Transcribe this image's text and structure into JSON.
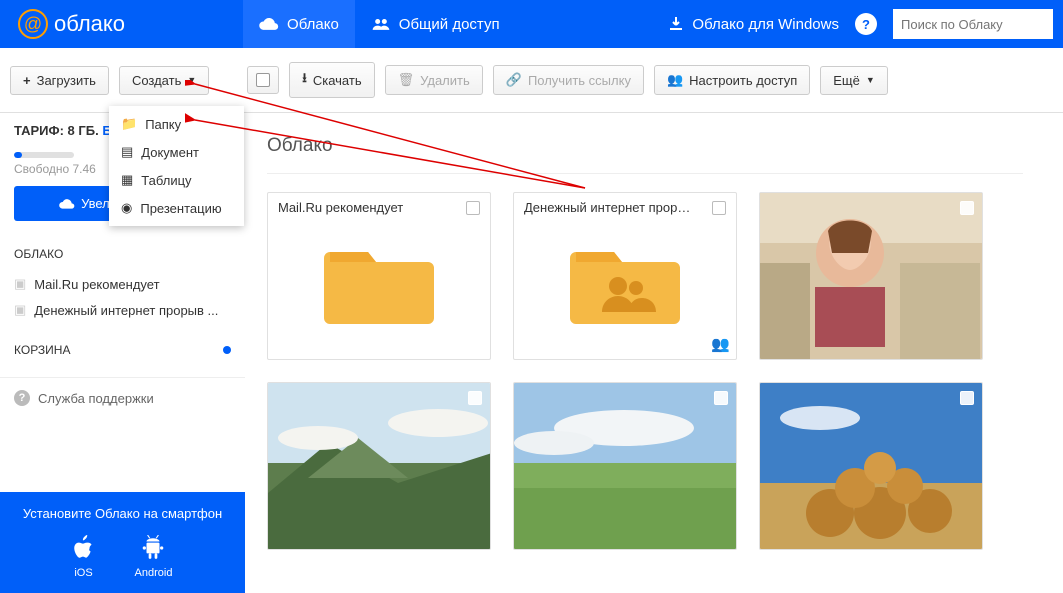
{
  "header": {
    "brand": "облако",
    "nav_cloud": "Облако",
    "nav_shared": "Общий доступ",
    "windows_link": "Облако для Windows",
    "search_placeholder": "Поиск по Облаку"
  },
  "toolbar": {
    "upload": "Загрузить",
    "create": "Создать",
    "download": "Скачать",
    "delete": "Удалить",
    "get_link": "Получить ссылку",
    "share_access": "Настроить доступ",
    "more": "Ещё"
  },
  "create_menu": {
    "folder": "Папку",
    "document": "Документ",
    "table": "Таблицу",
    "presentation": "Презентацию"
  },
  "sidebar": {
    "tariff_label": "ТАРИФ: 8 ГБ.",
    "tariff_suffix": "Б",
    "free_space": "Свободно 7.46",
    "increase": "Увеличить объем",
    "section_cloud": "ОБЛАКО",
    "items": [
      {
        "label": "Mail.Ru рекомендует"
      },
      {
        "label": "Денежный интернет прорыв ..."
      }
    ],
    "section_trash": "КОРЗИНА",
    "support": "Служба поддержки",
    "promo_title": "Установите Облако на смартфон",
    "promo_ios": "iOS",
    "promo_android": "Android"
  },
  "main": {
    "breadcrumb": "Облако",
    "tiles": [
      {
        "label": "Mail.Ru рекомендует",
        "type": "folder"
      },
      {
        "label": "Денежный интернет проры…",
        "type": "folder-shared"
      }
    ]
  }
}
